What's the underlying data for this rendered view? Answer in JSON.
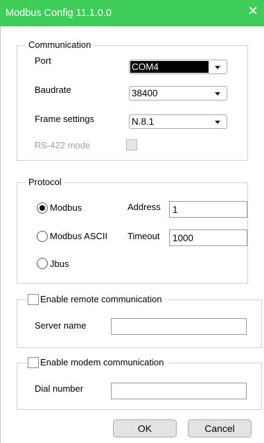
{
  "window": {
    "title": "Modbus Config 11.1.0.0",
    "close_glyph": "✕"
  },
  "communication": {
    "legend": "Communication",
    "port_label": "Port",
    "port_value": "COM4",
    "baudrate_label": "Baudrate",
    "baudrate_value": "38400",
    "frame_label": "Frame settings",
    "frame_value": "N.8.1",
    "rs422_label": "RS-422 mode",
    "rs422_checked": false,
    "rs422_enabled": false
  },
  "protocol": {
    "legend": "Protocol",
    "options": [
      {
        "label": "Modbus",
        "checked": true
      },
      {
        "label": "Modbus ASCII",
        "checked": false
      },
      {
        "label": "Jbus",
        "checked": false
      }
    ],
    "address_label": "Address",
    "address_value": "1",
    "timeout_label": "Timeout",
    "timeout_value": "1000"
  },
  "remote": {
    "legend": "Enable remote communication",
    "checked": false,
    "server_label": "Server name",
    "server_value": ""
  },
  "modem": {
    "legend": "Enable modem communication",
    "checked": false,
    "dial_label": "Dial number",
    "dial_value": ""
  },
  "buttons": {
    "ok": "OK",
    "cancel": "Cancel"
  },
  "colors": {
    "titlebar": "#3dcd58",
    "button_bg": "#e3e3e3",
    "group_border": "#cfcfcf"
  }
}
